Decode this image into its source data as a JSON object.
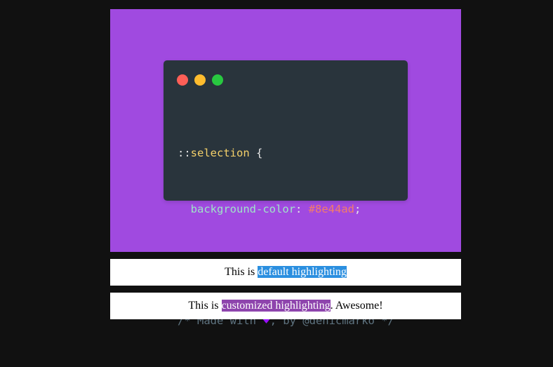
{
  "colors": {
    "page_background": "#111111",
    "poster_background": "#a04ae0",
    "code_window_background": "#29343c",
    "default_highlight": "#2b8fe0",
    "custom_highlight": "#8e44ad"
  },
  "code_window": {
    "controls": [
      "close-dot",
      "minimize-dot",
      "maximize-dot"
    ],
    "line1": {
      "prefix": "::",
      "selector": "selection",
      "brace": " {"
    },
    "line2": {
      "indent": "  ",
      "property": "background-color",
      "colon": ": ",
      "value": "#8e44ad",
      "semicolon": ";"
    },
    "line3": {
      "brace": "}"
    },
    "line4": {
      "before": "/* Made with ",
      "heart": "♥",
      "after": ", by @denicmarko */"
    }
  },
  "demo": {
    "row1": {
      "prefix": "This is ",
      "highlight": "default highlighting",
      "suffix": ""
    },
    "row2": {
      "prefix": "This is ",
      "highlight": "customized highlighting",
      "suffix": ". Awesome!"
    }
  }
}
